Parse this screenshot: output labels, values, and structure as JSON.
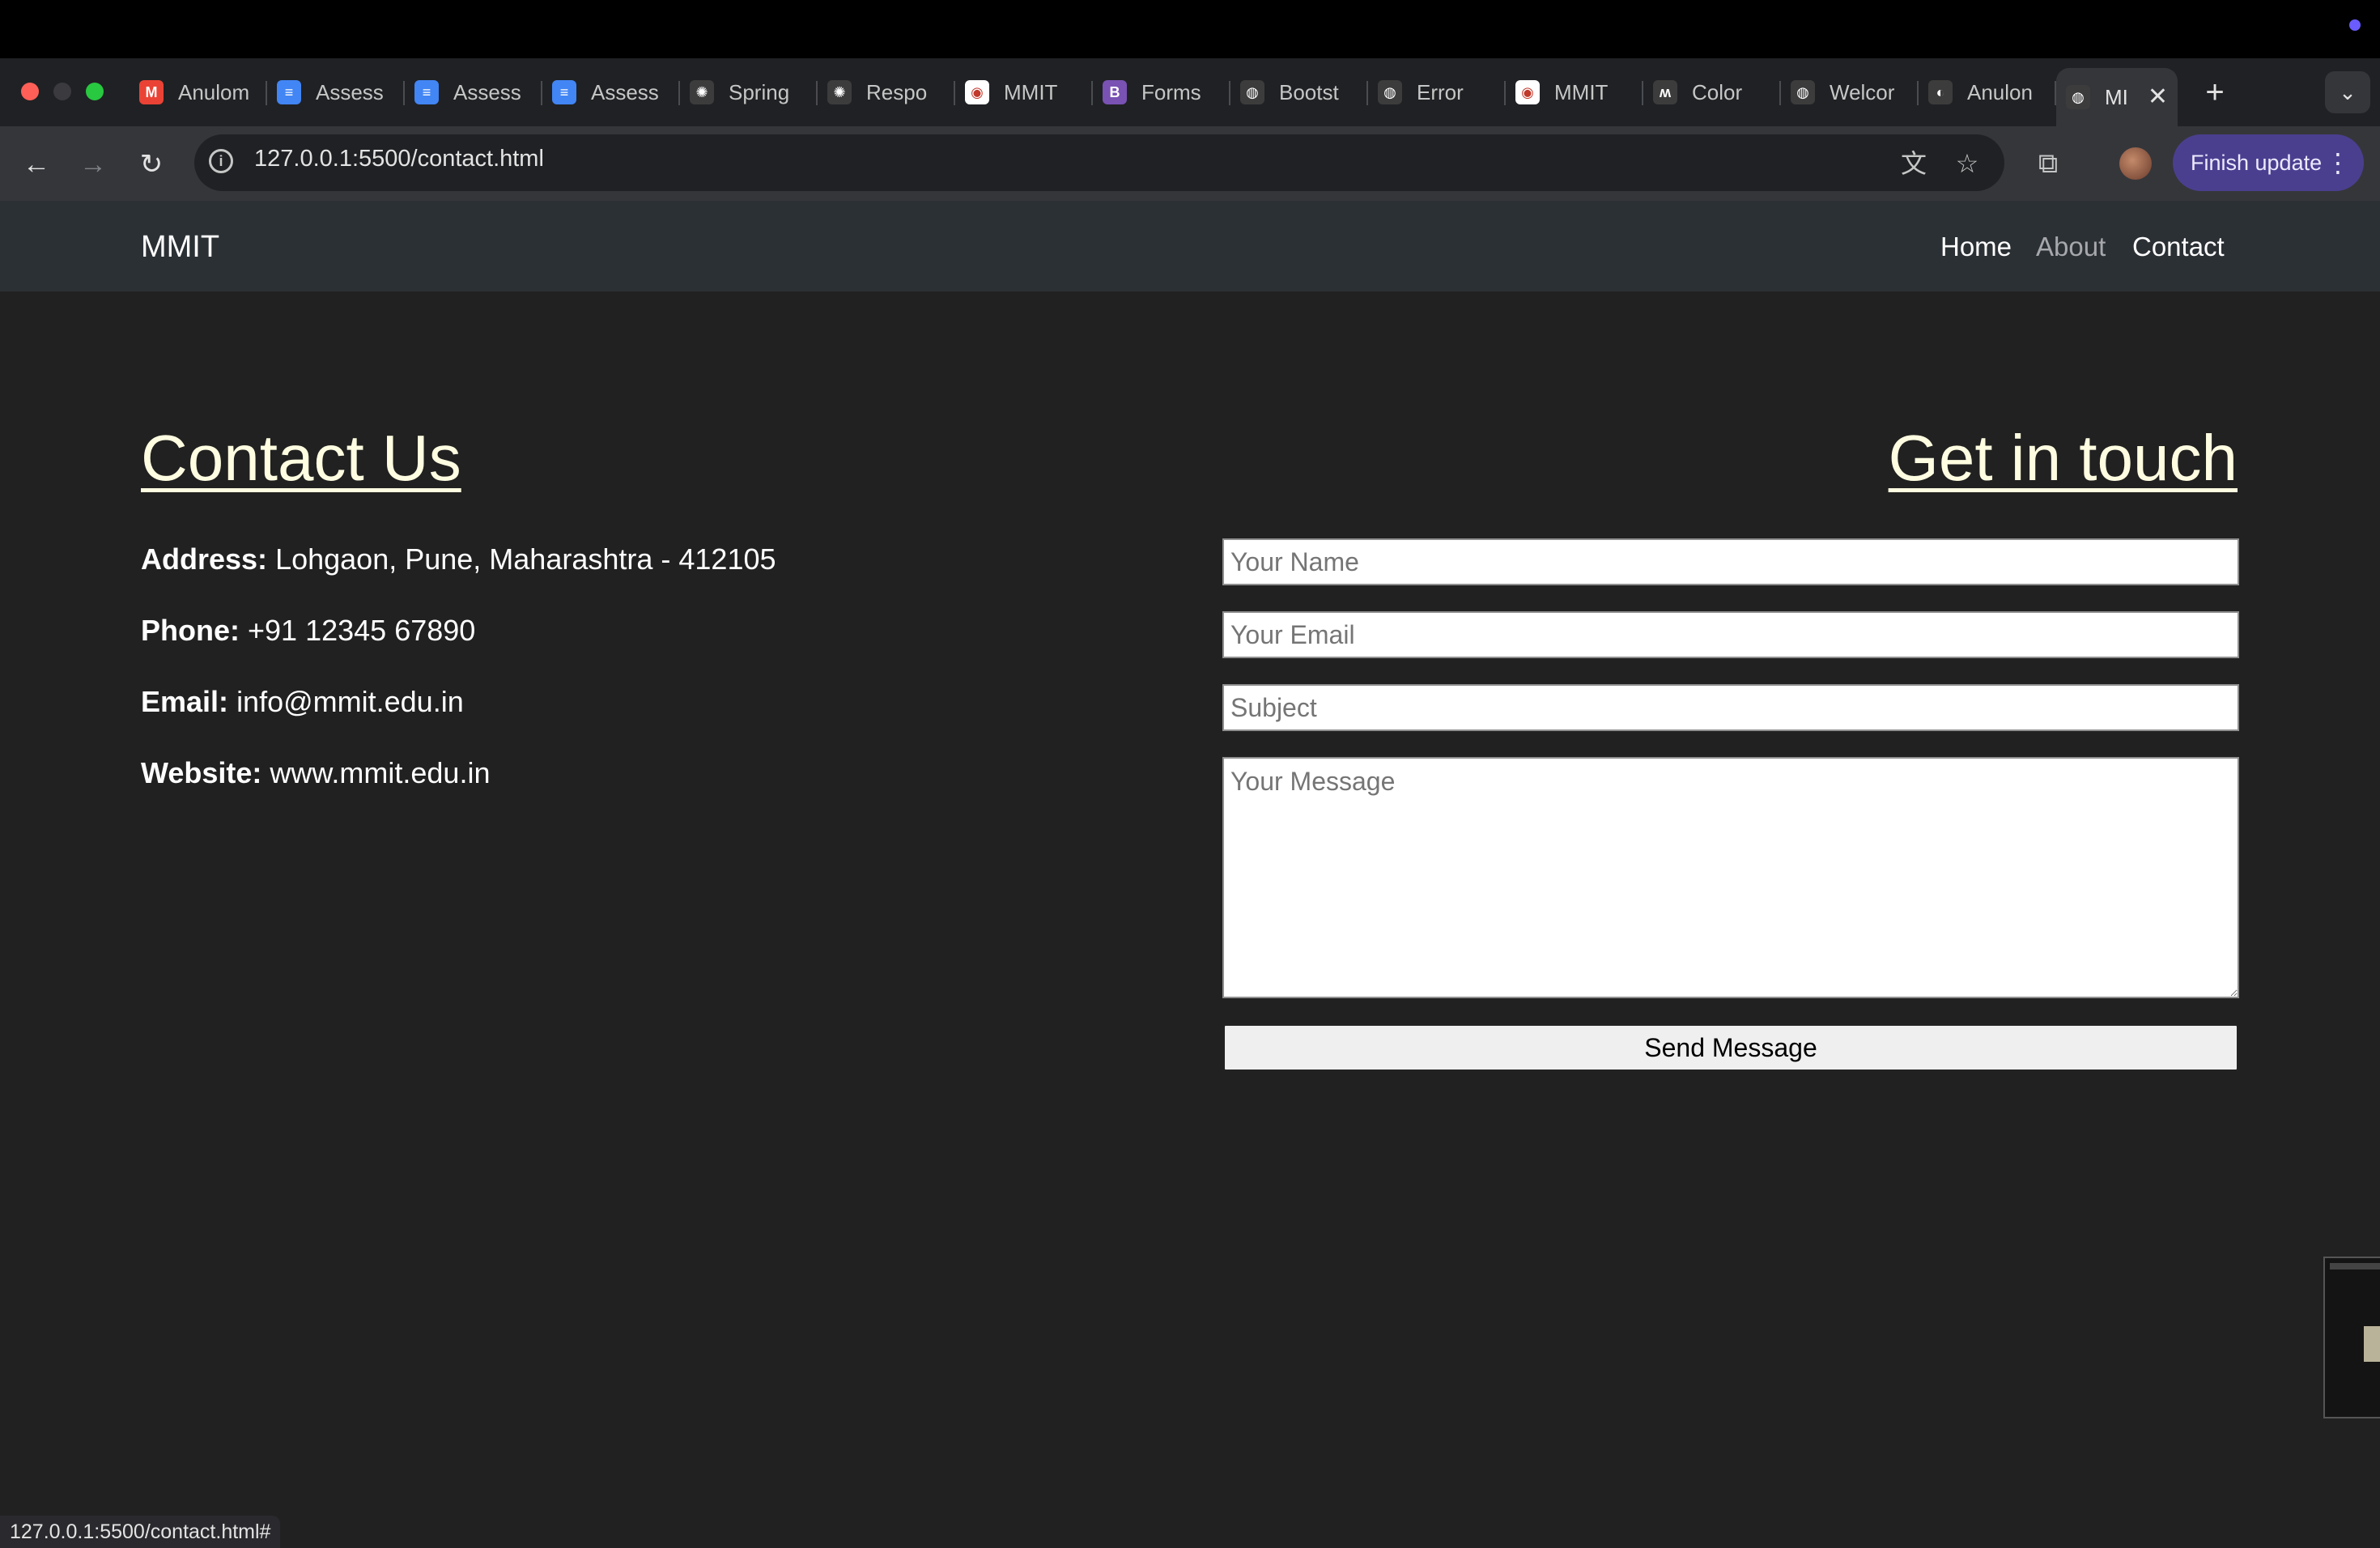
{
  "browser": {
    "tabs": [
      {
        "label": "Anulom",
        "icon": "gmail-icon",
        "color": "#ea4335"
      },
      {
        "label": "Assess",
        "icon": "google-docs-icon",
        "color": "#4285f4"
      },
      {
        "label": "Assess",
        "icon": "google-docs-icon",
        "color": "#4285f4"
      },
      {
        "label": "Assess",
        "icon": "google-docs-icon",
        "color": "#4285f4"
      },
      {
        "label": "Spring",
        "icon": "chatgpt-icon",
        "color": "#3c3c3c"
      },
      {
        "label": "Respo",
        "icon": "chatgpt-icon",
        "color": "#3c3c3c"
      },
      {
        "label": "MMIT",
        "icon": "mmit-logo-icon",
        "color": "#ffffff"
      },
      {
        "label": "Forms",
        "icon": "bootstrap-icon",
        "color": "#7952b3"
      },
      {
        "label": "Bootst",
        "icon": "globe-icon",
        "color": "#3c3c3c"
      },
      {
        "label": "Error",
        "icon": "globe-icon",
        "color": "#3c3c3c"
      },
      {
        "label": "MMIT",
        "icon": "mmit-logo-icon",
        "color": "#ffffff"
      },
      {
        "label": "Color",
        "icon": "coolors-icon",
        "color": "#3c3c3c"
      },
      {
        "label": "Welcor",
        "icon": "globe-icon",
        "color": "#3c3c3c"
      },
      {
        "label": "Anulon",
        "icon": "github-icon",
        "color": "#3c3c3c"
      }
    ],
    "active_tab": {
      "label": "MI",
      "icon": "globe-icon"
    },
    "url": "127.0.0.1:5500/contact.html",
    "finish_update_label": "Finish update",
    "status_url": "127.0.0.1:5500/contact.html#"
  },
  "page": {
    "brand": "MMIT",
    "nav": {
      "home": "Home",
      "about": "About",
      "contact": "Contact"
    },
    "contact_title": "Contact Us",
    "address_label": "Address:",
    "address_value": "Lohgaon, Pune, Maharashtra - 412105",
    "phone_label": "Phone:",
    "phone_value": "+91 12345 67890",
    "email_label": "Email:",
    "email_value": "info@mmit.edu.in",
    "website_label": "Website:",
    "website_value": "www.mmit.edu.in",
    "form_title": "Get in touch",
    "form": {
      "name_placeholder": "Your Name",
      "email_placeholder": "Your Email",
      "subject_placeholder": "Subject",
      "message_placeholder": "Your Message",
      "send_label": "Send Message"
    }
  },
  "colors": {
    "page_bg": "#212121",
    "navbar_bg": "#2b3035",
    "heading": "#fffde1",
    "finish_update_bg": "#4a3f8f"
  }
}
